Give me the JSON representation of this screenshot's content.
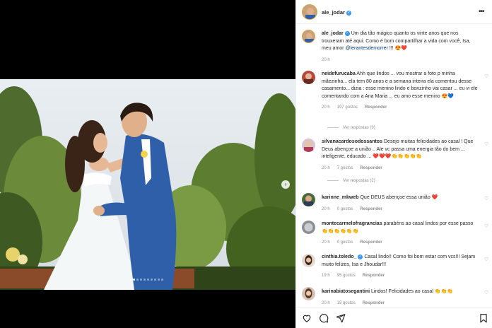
{
  "post": {
    "author": "ale_jodar",
    "caption": "Um dia tão mágico quanto os vinte anos que nos trouxeram até aqui. Como é bom compartilhar a vida com você, Isa, meu amor",
    "caption_mention": "@lerantesdemorrer",
    "caption_emoji": "!!! 😍❤️",
    "time": "20 h"
  },
  "header": {
    "username": "ale_jodar",
    "more": "•••"
  },
  "media": {
    "next_arrow": "›"
  },
  "comments": [
    {
      "user": "neidefurucaba",
      "text": "Ahh que lindos ... vou mostrar a foto p minha mãezinha... ela tem 80 anos e a semana inteira ela comentou desse casamento... dizia : esse menino lindo e bonzinho vai casar ... eu vi ele comentando com a Ana Maria ... eu amo esse menino 😍💙",
      "time": "20 h",
      "likes": "197 gostos",
      "reply": "Responder",
      "view_replies": "Ver respostas (9)"
    },
    {
      "user": "silvanacardosodossantos",
      "text": "Desejo muitas felicidades ao casal ! Que Deus abençoe a união .. Ale vc passa uma energia tão do bem ... inteligente, educado ... ❤️❤️❤️👏👏👏👏👏",
      "time": "20 h",
      "likes": "7 gostos",
      "reply": "Responder",
      "view_replies": "Ver respostas (2)"
    },
    {
      "user": "karinne_mkweb",
      "text": "Que DEUS abençoe essa união ❤️",
      "time": "20 h",
      "likes": "0 gostos",
      "reply": "Responder"
    },
    {
      "user": "montecarmelofragrancias",
      "text": "parabéns ao casal lindos por esse passo 👏👏👏👏👏👏",
      "time": "20 h",
      "likes": "0 gostos",
      "reply": "Responder"
    },
    {
      "user": "cinthia.toledo_",
      "text": "Casal lindo!! Como foi bom estar com vcs!!! Sejam muito felizes, Isa e Jhoudar!!!",
      "time": "19 h",
      "likes": "95 gostos",
      "reply": "Responder"
    },
    {
      "user": "karinabiatosegantini",
      "text": "Lindos! Felicidades ao casal 👏👏👏",
      "time": "20 h",
      "likes": "15 gostos",
      "reply": "Responder"
    }
  ],
  "colors": {
    "verified": "#3897f0",
    "like": "#ed4956",
    "muted": "#8e8e8e",
    "link": "#00376b"
  },
  "icons": [
    "heart-icon",
    "comment-icon",
    "share-icon",
    "bookmark-icon",
    "more-icon",
    "verified-icon"
  ]
}
